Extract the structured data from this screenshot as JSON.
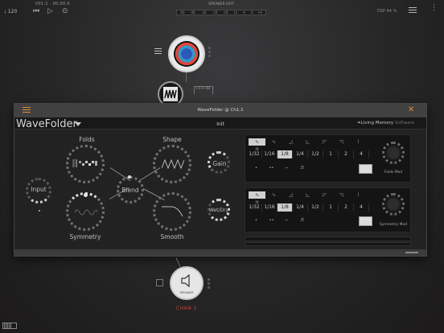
{
  "topbar": {
    "tempo": "♩ 120",
    "time": "001:1 · 00:00.0",
    "meter_title": "SPEAKER OUT",
    "meter_ticks": [
      "-60",
      "-48",
      "-36",
      "-24",
      "-18",
      "-12",
      "-6",
      "0",
      "+6"
    ],
    "dsp": "DSP 44 %"
  },
  "graph": {
    "mid_node_label": "+0.0 dB"
  },
  "plugin": {
    "window_title": "WaveFolder @ Ch1:1",
    "name": "WaveFolder",
    "preset": "Init",
    "vendor_main": "Living Memory",
    "vendor_suffix": "Software",
    "knobs": {
      "folds": "Folds",
      "shape": "Shape",
      "gain": "Gain",
      "input": "Input",
      "blend": "Blend",
      "symmetry": "Symmetry",
      "smooth": "Smooth",
      "wetdry": "Wet/Dry"
    },
    "lfo1": {
      "waves": [
        "∿",
        "∿",
        "◿",
        "◺",
        "◸",
        "◹",
        "⌇",
        "≋"
      ],
      "divisions": [
        "1/32",
        "1/16",
        "1/8",
        "1/4",
        "1/2",
        "1",
        "2",
        "4"
      ],
      "selected_division": "1/8",
      "patterns": [
        "•",
        "••",
        "⌐",
        "♬"
      ],
      "mod_label": "Folds Mod"
    },
    "lfo2": {
      "waves": [
        "∿",
        "∿",
        "◿",
        "◺",
        "◸",
        "◹",
        "⌇",
        "≋"
      ],
      "divisions": [
        "1/32",
        "1/16",
        "1/8",
        "1/4",
        "1/2",
        "1",
        "2",
        "4"
      ],
      "selected_division": "1/8",
      "patterns": [
        "•",
        "••",
        "⌐",
        "♬"
      ],
      "mod_label": "Symmetry Mod"
    }
  },
  "output": {
    "node_label": "SPEAKER",
    "channel": "CHAN 1"
  },
  "colors": {
    "accent": "#e08b3b",
    "channel_red": "#c9483a",
    "vendor_blue": "#7fb3d6"
  }
}
